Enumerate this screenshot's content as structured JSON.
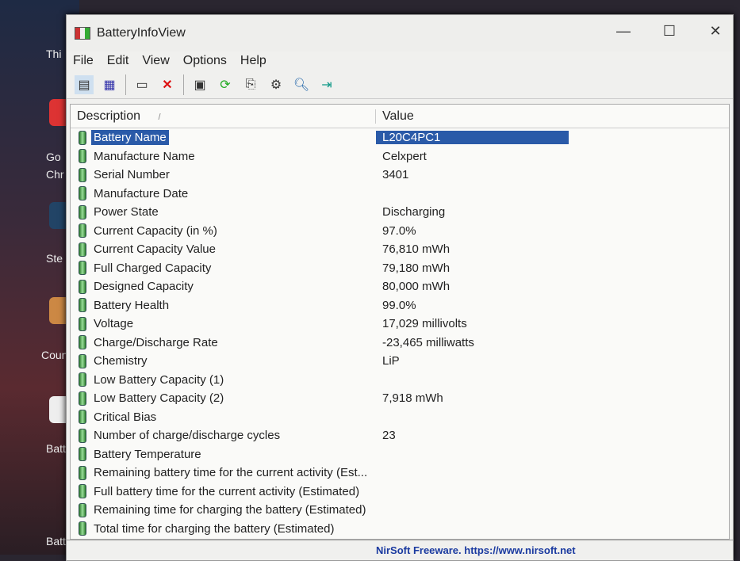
{
  "desktop": {
    "labels": [
      "Thi",
      "Go",
      "Chr",
      "Ste",
      "Count",
      "Batte",
      "Batte"
    ]
  },
  "window": {
    "title": "BatteryInfoView",
    "min": "—",
    "max": "☐",
    "close": "✕"
  },
  "menu": [
    "File",
    "Edit",
    "View",
    "Options",
    "Help"
  ],
  "toolbar": [
    "properties-icon",
    "clipboard-icon",
    "html-report-icon",
    "delete-icon",
    "save-icon",
    "refresh-icon",
    "copy-icon",
    "options-icon",
    "find-icon",
    "exit-icon"
  ],
  "columns": {
    "description": "Description",
    "sort": "/",
    "value": "Value"
  },
  "rows": [
    {
      "d": "Battery Name",
      "v": "L20C4PC1"
    },
    {
      "d": "Manufacture Name",
      "v": "Celxpert"
    },
    {
      "d": "Serial Number",
      "v": "3401"
    },
    {
      "d": "Manufacture Date",
      "v": ""
    },
    {
      "d": "Power State",
      "v": "Discharging"
    },
    {
      "d": "Current Capacity (in %)",
      "v": "97.0%"
    },
    {
      "d": "Current Capacity Value",
      "v": "76,810 mWh"
    },
    {
      "d": "Full Charged Capacity",
      "v": "79,180 mWh"
    },
    {
      "d": "Designed Capacity",
      "v": "80,000 mWh"
    },
    {
      "d": "Battery Health",
      "v": "99.0%"
    },
    {
      "d": "Voltage",
      "v": "17,029 millivolts"
    },
    {
      "d": "Charge/Discharge Rate",
      "v": "-23,465 milliwatts"
    },
    {
      "d": "Chemistry",
      "v": "LiP"
    },
    {
      "d": "Low Battery Capacity (1)",
      "v": ""
    },
    {
      "d": "Low Battery Capacity (2)",
      "v": "7,918 mWh"
    },
    {
      "d": "Critical Bias",
      "v": ""
    },
    {
      "d": "Number of charge/discharge cycles",
      "v": "23"
    },
    {
      "d": "Battery Temperature",
      "v": ""
    },
    {
      "d": "Remaining battery time for the current activity (Est...",
      "v": ""
    },
    {
      "d": "Full battery time for the current activity (Estimated)",
      "v": ""
    },
    {
      "d": "Remaining time for charging the battery (Estimated)",
      "v": ""
    },
    {
      "d": "Total  time for charging the battery (Estimated)",
      "v": ""
    }
  ],
  "status": "NirSoft Freeware. https://www.nirsoft.net"
}
